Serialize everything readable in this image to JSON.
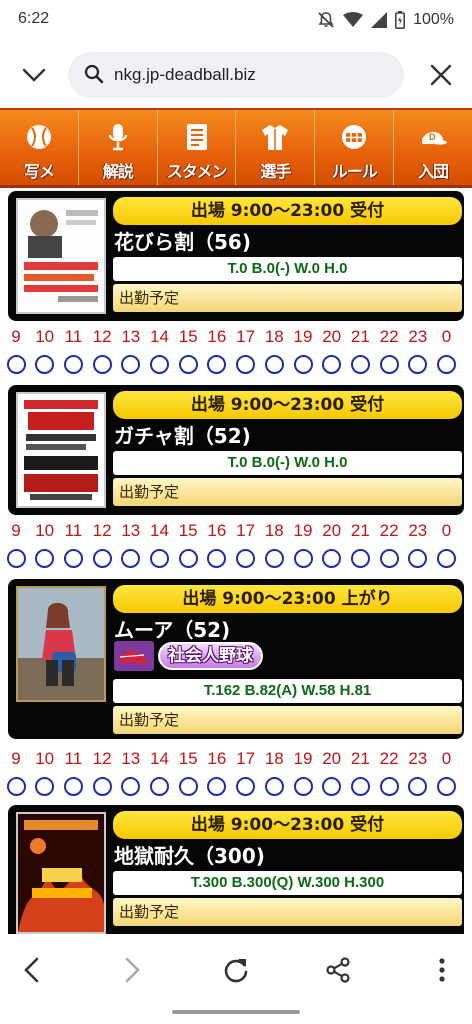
{
  "status_bar": {
    "time": "6:22",
    "battery": "100%"
  },
  "browser": {
    "url": "nkg.jp-deadball.biz"
  },
  "site_nav": [
    {
      "label": "写メ",
      "icon": "baseball-icon"
    },
    {
      "label": "解説",
      "icon": "microphone-icon"
    },
    {
      "label": "スタメン",
      "icon": "lineup-sheet-icon"
    },
    {
      "label": "選手",
      "icon": "uniform-icon"
    },
    {
      "label": "ルール",
      "icon": "umpire-mask-icon"
    },
    {
      "label": "入団",
      "icon": "cap-icon"
    }
  ],
  "cards": [
    {
      "badge": "出場 9:00〜23:00 受付",
      "name": "花びら割（56)",
      "stats": "T.0 B.0(-) W.0 H.0",
      "plan": "出勤予定",
      "tag": "",
      "hours": [
        "9",
        "10",
        "11",
        "12",
        "13",
        "14",
        "15",
        "16",
        "17",
        "18",
        "19",
        "20",
        "21",
        "22",
        "23",
        "0"
      ],
      "availability": [
        "○",
        "○",
        "○",
        "○",
        "○",
        "○",
        "○",
        "○",
        "○",
        "○",
        "○",
        "○",
        "○",
        "○",
        "○",
        "○"
      ]
    },
    {
      "badge": "出場 9:00〜23:00 受付",
      "name": "ガチャ割（52)",
      "stats": "T.0 B.0(-) W.0 H.0",
      "plan": "出勤予定",
      "tag": "",
      "hours": [
        "9",
        "10",
        "11",
        "12",
        "13",
        "14",
        "15",
        "16",
        "17",
        "18",
        "19",
        "20",
        "21",
        "22",
        "23",
        "0"
      ],
      "availability": [
        "○",
        "○",
        "○",
        "○",
        "○",
        "○",
        "○",
        "○",
        "○",
        "○",
        "○",
        "○",
        "○",
        "○",
        "○",
        "○"
      ]
    },
    {
      "badge": "出場 9:00〜23:00 上がり",
      "name": "ムーア（52)",
      "stats": "T.162 B.82(A) W.58 H.81",
      "plan": "出勤予定",
      "tag": "社会人野球",
      "hours": [
        "9",
        "10",
        "11",
        "12",
        "13",
        "14",
        "15",
        "16",
        "17",
        "18",
        "19",
        "20",
        "21",
        "22",
        "23",
        "0"
      ],
      "availability": [
        "○",
        "○",
        "○",
        "○",
        "○",
        "○",
        "○",
        "○",
        "○",
        "○",
        "○",
        "○",
        "○",
        "○",
        "○",
        "○"
      ]
    },
    {
      "badge": "出場 9:00〜23:00 受付",
      "name": "地獄耐久（300)",
      "stats": "T.300 B.300(Q) W.300 H.300",
      "plan": "出勤予定",
      "tag": ""
    }
  ],
  "colors": {
    "nav_orange": "#e8640b",
    "badge_yellow": "#f5c800",
    "hour_red": "#c21515",
    "circle_blue": "#1d2fa8"
  }
}
